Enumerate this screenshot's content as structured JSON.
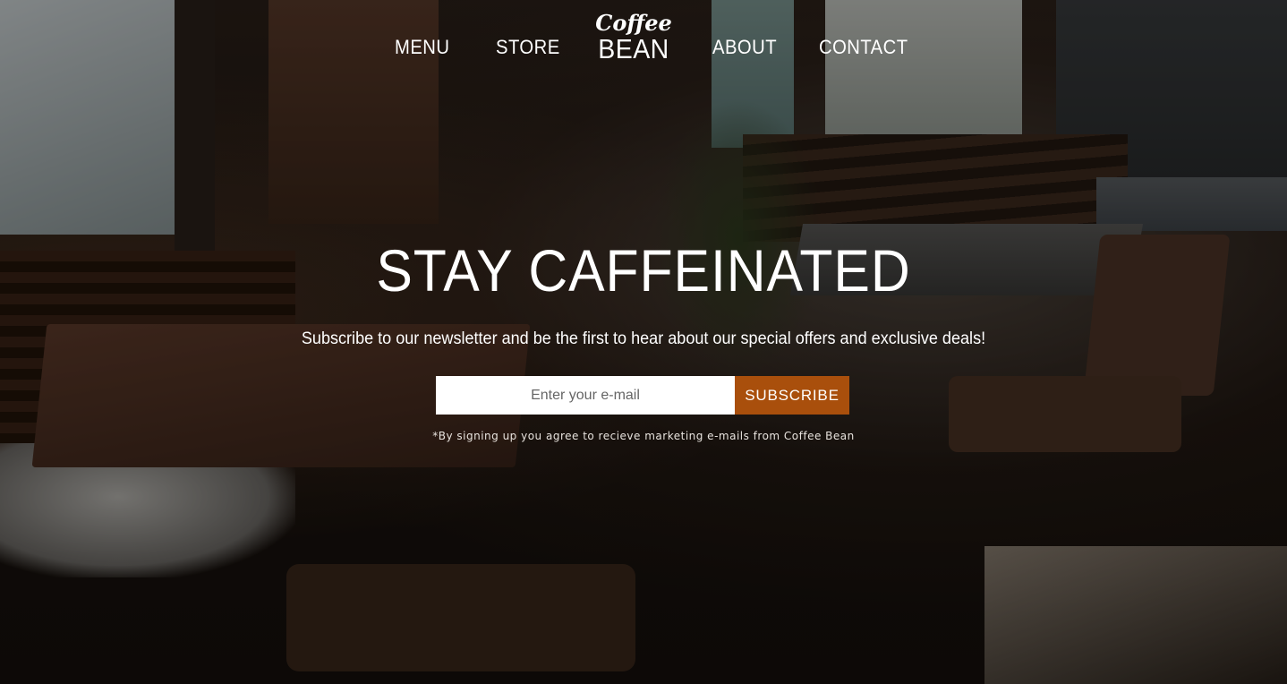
{
  "nav": {
    "items": [
      {
        "label": "MENU"
      },
      {
        "label": "STORE"
      },
      {
        "label": "ABOUT"
      },
      {
        "label": "CONTACT"
      }
    ],
    "logo": {
      "top": "Coffee",
      "bottom": "BEAN"
    }
  },
  "hero": {
    "title": "STAY CAFFEINATED",
    "subtitle": "Subscribe to our newsletter and be the first to hear about our special offers and exclusive deals!",
    "email_placeholder": "Enter your e-mail",
    "subscribe_label": "SUBSCRIBE",
    "disclaimer": "*By signing up you agree to recieve marketing e-mails from Coffee Bean"
  },
  "colors": {
    "accent": "#a94f0c",
    "text": "#ffffff"
  },
  "icons": []
}
